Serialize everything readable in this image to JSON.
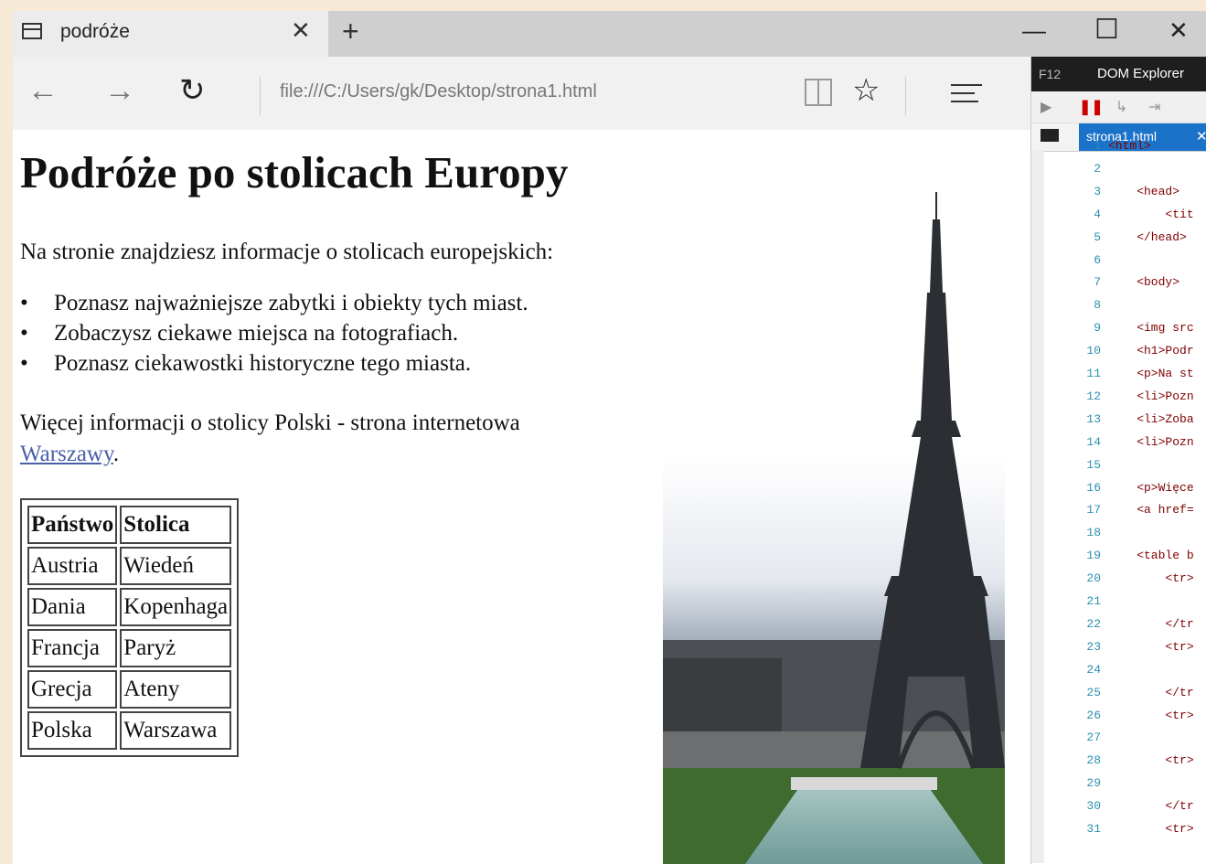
{
  "browser": {
    "tab_title": "podróże",
    "tab_close": "✕",
    "new_tab": "+",
    "url": "file:///C:/Users/gk/Desktop/strona1.html",
    "minimize": "—",
    "maximize": "☐",
    "close": "✕",
    "back_icon": "arrow-left-icon",
    "forward_icon": "arrow-right-icon",
    "refresh_icon": "refresh-icon"
  },
  "page": {
    "heading": "Podróże po stolicach Europy",
    "intro": "Na stronie znajdziesz informacje o stolicach europejskich:",
    "list": [
      "Poznasz najważniejsze zabytki i obiekty tych miast.",
      "Zobaczysz ciekawe miejsca na fotografiach.",
      "Poznasz ciekawostki historyczne tego miasta."
    ],
    "more_text": "Więcej informacji o stolicy Polski - strona internetowa",
    "more_link": "Warszawy",
    "more_end": ".",
    "table": {
      "headers": [
        "Państwo",
        "Stolica"
      ],
      "rows": [
        [
          "Austria",
          "Wiedeń"
        ],
        [
          "Dania",
          "Kopenhaga"
        ],
        [
          "Francja",
          "Paryż"
        ],
        [
          "Grecja",
          "Ateny"
        ],
        [
          "Polska",
          "Warszawa"
        ]
      ]
    }
  },
  "devtools": {
    "f12": "F12",
    "panel": "DOM Explorer",
    "file_tab": "strona1.html",
    "file_tab_close": "✕",
    "lines": [
      {
        "n": "1",
        "t": "<html>"
      },
      {
        "n": "2",
        "t": ""
      },
      {
        "n": "3",
        "t": "    <head>"
      },
      {
        "n": "4",
        "t": "        <tit"
      },
      {
        "n": "5",
        "t": "    </head>"
      },
      {
        "n": "6",
        "t": ""
      },
      {
        "n": "7",
        "t": "    <body>"
      },
      {
        "n": "8",
        "t": ""
      },
      {
        "n": "9",
        "t": "    <img src"
      },
      {
        "n": "10",
        "t": "    <h1>Podr"
      },
      {
        "n": "11",
        "t": "    <p>Na st"
      },
      {
        "n": "12",
        "t": "    <li>Pozn"
      },
      {
        "n": "13",
        "t": "    <li>Zoba"
      },
      {
        "n": "14",
        "t": "    <li>Pozn"
      },
      {
        "n": "15",
        "t": ""
      },
      {
        "n": "16",
        "t": "    <p>Więce"
      },
      {
        "n": "17",
        "t": "    <a href="
      },
      {
        "n": "18",
        "t": ""
      },
      {
        "n": "19",
        "t": "    <table b"
      },
      {
        "n": "20",
        "t": "        <tr>"
      },
      {
        "n": "21",
        "t": ""
      },
      {
        "n": "22",
        "t": "        </tr"
      },
      {
        "n": "23",
        "t": "        <tr>"
      },
      {
        "n": "24",
        "t": ""
      },
      {
        "n": "25",
        "t": "        </tr"
      },
      {
        "n": "26",
        "t": "        <tr>"
      },
      {
        "n": "27",
        "t": ""
      },
      {
        "n": "28",
        "t": "        <tr>"
      },
      {
        "n": "29",
        "t": ""
      },
      {
        "n": "30",
        "t": "        </tr"
      },
      {
        "n": "31",
        "t": "        <tr>"
      }
    ]
  }
}
